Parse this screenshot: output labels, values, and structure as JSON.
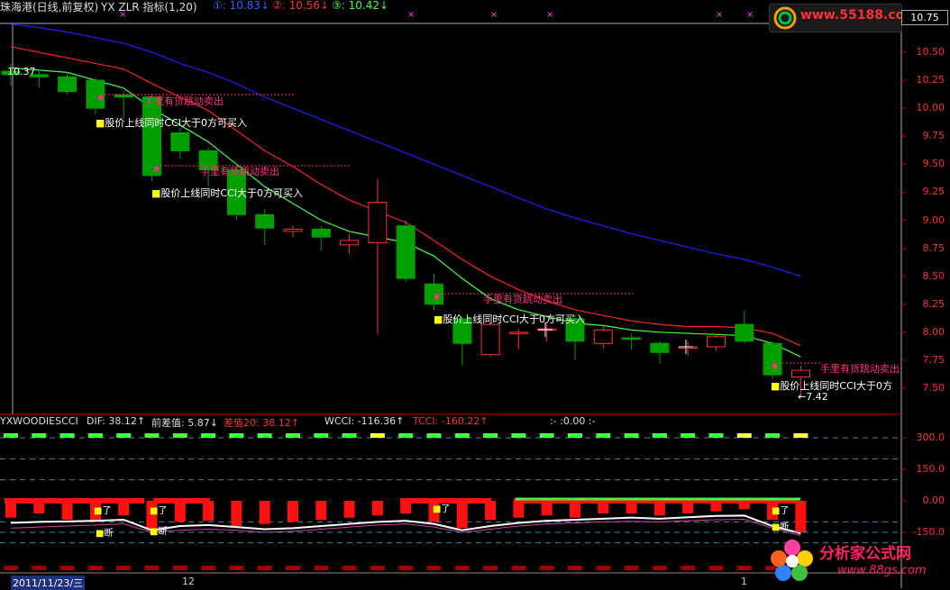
{
  "header": {
    "title": "珠海港(日线,前复权)",
    "indicator": "YX  ZLR 指标(1,20)",
    "ma1": "①: 10.83↓",
    "ma2": "②: 10.56↓",
    "ma3": "③: 10.42↓"
  },
  "current_price_box": "10.75",
  "logo_top_text": "www.55188.com",
  "price_axis": [
    "10.50",
    "10.25",
    "10.00",
    "9.75",
    "9.50",
    "9.25",
    "9.00",
    "8.75",
    "8.50",
    "8.25",
    "8.00",
    "7.75",
    "7.50"
  ],
  "high_label": "10.37",
  "low_label": "←7.42",
  "annotations": {
    "sell": "手里有货跳动卖出",
    "buy": "股价上线同时CCI大于0方可买入",
    "sell_last": "手里有货跳动卖出",
    "buy_last": "股价上线同时CCI大于0方"
  },
  "sub_header": {
    "name": "YXWOODIESCCI",
    "dif": "DIF: 38.12↑",
    "prev_diff": "前差值: 5.87↓",
    "diff20": "差值20: 38.12↑",
    "wcci": "WCCI: -116.36↑",
    "tcci": "TCCI: -160.22↑",
    "misc": ":- :0.00 :-"
  },
  "sub_axis": [
    "300.0",
    "150.0",
    "0.00",
    "-150.0"
  ],
  "signal_labels": {
    "up": "了",
    "down": "断"
  },
  "date_bar": {
    "date": "2011/11/23/三",
    "m1": "12",
    "m2": "1"
  },
  "logo_bottom": {
    "title": "分析家公式网",
    "url": "www.88gs.com"
  },
  "colors": {
    "up": "#ff3030",
    "down": "#00a000",
    "ma_short": "#40ff40",
    "ma_mid": "#ff2020",
    "ma_long": "#2020ff",
    "sell_text": "#ff3080",
    "buy_marker": "#ffff00"
  },
  "chart_data": {
    "type": "candlestick",
    "price_range": [
      7.35,
      10.7
    ],
    "candles": [
      {
        "o": 10.33,
        "c": 10.3,
        "h": 10.4,
        "l": 10.2
      },
      {
        "o": 10.3,
        "c": 10.28,
        "h": 10.35,
        "l": 10.18
      },
      {
        "o": 10.28,
        "c": 10.15,
        "h": 10.32,
        "l": 10.12
      },
      {
        "o": 10.25,
        "c": 10.0,
        "h": 10.27,
        "l": 9.95
      },
      {
        "o": 10.12,
        "c": 10.1,
        "h": 10.15,
        "l": 9.9
      },
      {
        "o": 10.1,
        "c": 9.4,
        "h": 10.12,
        "l": 9.35
      },
      {
        "o": 9.78,
        "c": 9.62,
        "h": 9.82,
        "l": 9.55
      },
      {
        "o": 9.62,
        "c": 9.45,
        "h": 9.65,
        "l": 9.3
      },
      {
        "o": 9.45,
        "c": 9.05,
        "h": 9.5,
        "l": 9.0
      },
      {
        "o": 9.05,
        "c": 8.93,
        "h": 9.1,
        "l": 8.78
      },
      {
        "o": 8.9,
        "c": 8.92,
        "h": 8.95,
        "l": 8.85
      },
      {
        "o": 8.92,
        "c": 8.85,
        "h": 8.95,
        "l": 8.73
      },
      {
        "o": 8.78,
        "c": 8.82,
        "h": 8.88,
        "l": 8.7
      },
      {
        "o": 8.8,
        "c": 9.16,
        "h": 9.37,
        "l": 7.98
      },
      {
        "o": 8.95,
        "c": 8.48,
        "h": 9.0,
        "l": 8.45
      },
      {
        "o": 8.43,
        "c": 8.25,
        "h": 8.52,
        "l": 8.2
      },
      {
        "o": 8.12,
        "c": 7.9,
        "h": 8.13,
        "l": 7.7
      },
      {
        "o": 7.8,
        "c": 8.07,
        "h": 8.08,
        "l": 7.78
      },
      {
        "o": 7.99,
        "c": 8.0,
        "h": 8.03,
        "l": 7.85
      },
      {
        "o": 8.02,
        "c": 8.03,
        "h": 8.07,
        "l": 7.92
      },
      {
        "o": 8.12,
        "c": 7.92,
        "h": 8.15,
        "l": 7.75
      },
      {
        "o": 7.9,
        "c": 8.02,
        "h": 8.06,
        "l": 7.85
      },
      {
        "o": 7.95,
        "c": 7.94,
        "h": 7.98,
        "l": 7.85
      },
      {
        "o": 7.9,
        "c": 7.82,
        "h": 7.92,
        "l": 7.72
      },
      {
        "o": 7.87,
        "c": 7.87,
        "h": 7.92,
        "l": 7.79
      },
      {
        "o": 7.87,
        "c": 7.96,
        "h": 7.98,
        "l": 7.84
      },
      {
        "o": 8.07,
        "c": 7.92,
        "h": 8.19,
        "l": 7.9
      },
      {
        "o": 7.9,
        "c": 7.62,
        "h": 7.92,
        "l": 7.58
      },
      {
        "o": 7.6,
        "c": 7.66,
        "h": 7.7,
        "l": 7.42
      }
    ],
    "ma_short": [
      10.36,
      10.34,
      10.32,
      10.25,
      10.18,
      10.0,
      9.85,
      9.7,
      9.5,
      9.3,
      9.15,
      9.0,
      8.9,
      8.85,
      8.8,
      8.68,
      8.48,
      8.3,
      8.2,
      8.14,
      8.08,
      8.06,
      8.02,
      8.0,
      7.99,
      7.98,
      7.97,
      7.9,
      7.78
    ],
    "ma_mid": [
      10.55,
      10.5,
      10.45,
      10.4,
      10.35,
      10.22,
      10.1,
      9.98,
      9.8,
      9.62,
      9.48,
      9.32,
      9.18,
      9.08,
      8.98,
      8.82,
      8.65,
      8.5,
      8.38,
      8.28,
      8.2,
      8.15,
      8.1,
      8.07,
      8.05,
      8.05,
      8.04,
      7.99,
      7.88
    ],
    "ma_long": [
      10.75,
      10.72,
      10.68,
      10.63,
      10.58,
      10.5,
      10.4,
      10.32,
      10.22,
      10.1,
      10.0,
      9.9,
      9.8,
      9.7,
      9.6,
      9.5,
      9.4,
      9.3,
      9.2,
      9.1,
      9.02,
      8.95,
      8.88,
      8.82,
      8.76,
      8.7,
      8.65,
      8.58,
      8.5
    ]
  }
}
